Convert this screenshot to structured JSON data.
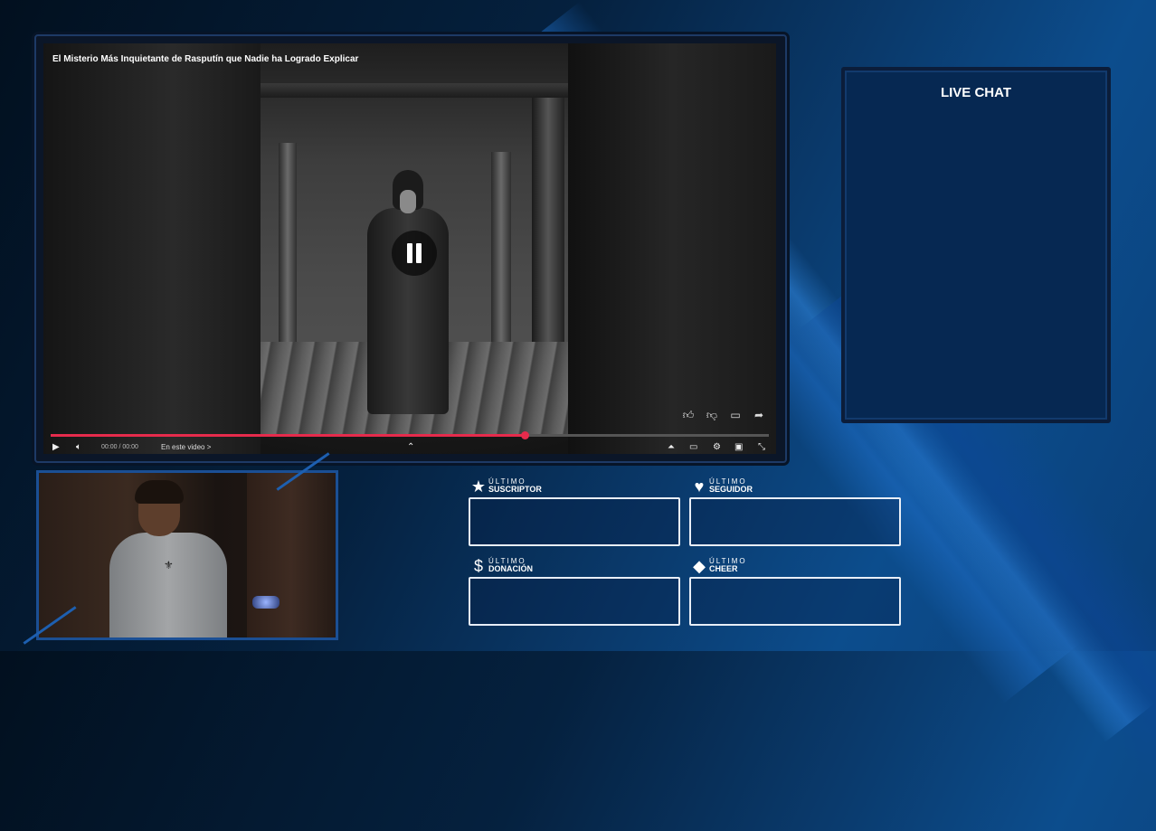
{
  "video": {
    "title": "El Misterio Más Inquietante de Rasputín que Nadie ha Logrado Explicar",
    "progress_fraction": 0.66,
    "time": "00:00 / 00:00",
    "see_video": "En este video >",
    "actions": [
      "like-icon",
      "dislike-icon",
      "comment-icon",
      "share-icon"
    ]
  },
  "chat": {
    "title": "LIVE CHAT"
  },
  "stats": [
    {
      "icon": "★",
      "icon_name": "star-icon",
      "small": "ÚLTIMO",
      "big": "SUSCRIPTOR"
    },
    {
      "icon": "♥",
      "icon_name": "heart-icon",
      "small": "ÚLTIMO",
      "big": "SEGUIDOR"
    },
    {
      "icon": "$",
      "icon_name": "dollar-icon",
      "small": "ÚLTIMO",
      "big": "DONACIÓN"
    },
    {
      "icon": "◆",
      "icon_name": "diamond-icon",
      "small": "ÚLTIMO",
      "big": "CHEER"
    }
  ],
  "colors": {
    "progress": "#e62b4c",
    "accent": "#1b4f94",
    "chat_bg": "#062852"
  }
}
